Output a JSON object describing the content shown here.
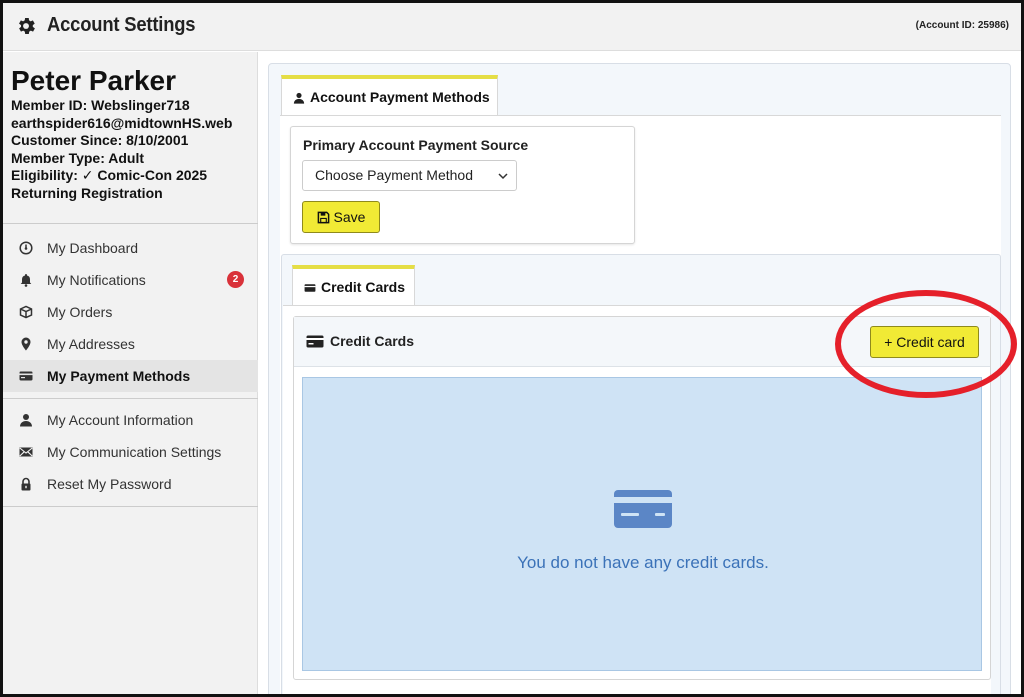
{
  "header": {
    "title": "Account Settings",
    "account_id": "(Account ID: 25986)"
  },
  "profile": {
    "name": "Peter Parker",
    "member_id": "Member ID: Webslinger718",
    "email": "earthspider616@midtownHS.web",
    "customer_since": "Customer Since: 8/10/2001",
    "member_type": "Member Type: Adult",
    "eligibility": "Eligibility: ✓ Comic-Con 2025",
    "registration": "Returning Registration"
  },
  "sidebar": {
    "group1": [
      {
        "label": "My Dashboard",
        "icon": "dashboard-icon"
      },
      {
        "label": "My Notifications",
        "icon": "bell-icon",
        "badge": "2"
      },
      {
        "label": "My Orders",
        "icon": "box-icon"
      },
      {
        "label": "My Addresses",
        "icon": "map-pin-icon"
      },
      {
        "label": "My Payment Methods",
        "icon": "credit-card-icon",
        "active": true
      }
    ],
    "group2": [
      {
        "label": "My Account Information",
        "icon": "user-icon"
      },
      {
        "label": "My Communication Settings",
        "icon": "envelope-icon"
      },
      {
        "label": "Reset My Password",
        "icon": "lock-icon"
      }
    ]
  },
  "main": {
    "tab_label": "Account Payment Methods",
    "primary_source_label": "Primary Account Payment Source",
    "select_value": "Choose Payment Method",
    "save_label": "Save",
    "cc_tab_label": "Credit Cards",
    "cc_card_title": "Credit Cards",
    "add_button_label": "+ Credit card",
    "empty_message": "You do not have any credit cards."
  },
  "colors": {
    "accent_yellow": "#f1ea35",
    "tab_top_border": "#e5de45",
    "badge_red": "#d9323a",
    "empty_bg": "#cfe3f5",
    "empty_text": "#3b72b8",
    "highlight_red": "#e5202a"
  }
}
